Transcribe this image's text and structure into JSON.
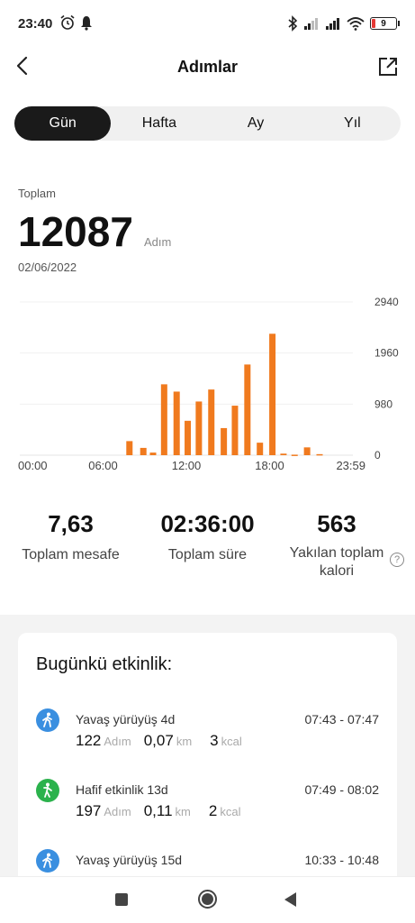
{
  "status_bar": {
    "time": "23:40",
    "battery": "9",
    "icons": [
      "alarm-icon",
      "bell-icon",
      "bluetooth-icon",
      "signal-icon",
      "signal-icon",
      "wifi-icon",
      "battery-icon"
    ]
  },
  "header": {
    "title": "Adımlar",
    "back_icon": "back-arrow-icon",
    "share_icon": "share-icon"
  },
  "tabs": [
    {
      "label": "Gün",
      "active": true
    },
    {
      "label": "Hafta",
      "active": false
    },
    {
      "label": "Ay",
      "active": false
    },
    {
      "label": "Yıl",
      "active": false
    }
  ],
  "summary": {
    "label": "Toplam",
    "steps": "12087",
    "unit": "Adım",
    "date": "02/06/2022"
  },
  "chart_data": {
    "type": "bar",
    "title": "",
    "xlabel": "",
    "ylabel": "",
    "x_tick_labels": [
      "00:00",
      "06:00",
      "12:00",
      "18:00",
      "23:59"
    ],
    "y_tick_labels": [
      "2940",
      "1960",
      "980",
      "0"
    ],
    "ylim": [
      0,
      2940
    ],
    "bar_color": "#f07a1e",
    "grid": true,
    "x_unit": "hour of day",
    "x": [
      7.9,
      8.9,
      9.6,
      10.4,
      11.3,
      12.1,
      12.9,
      13.8,
      14.7,
      15.5,
      16.4,
      17.3,
      18.2,
      19.0,
      19.8,
      20.7,
      21.6
    ],
    "values": [
      270,
      140,
      50,
      1360,
      1220,
      660,
      1030,
      1260,
      520,
      950,
      1740,
      240,
      2330,
      30,
      10,
      150,
      20
    ]
  },
  "stats": {
    "distance": {
      "value": "7,63",
      "label": "Toplam mesafe"
    },
    "duration": {
      "value": "02:36:00",
      "label": "Toplam süre"
    },
    "calories": {
      "value": "563",
      "label_line1": "Yakılan toplam",
      "label_line2": "kalori"
    }
  },
  "activity": {
    "title": "Bugünkü etkinlik:",
    "items": [
      {
        "name": "Yavaş yürüyüş 4d",
        "time": "07:43 - 07:47",
        "steps": "122",
        "steps_unit": "Adım",
        "km": "0,07",
        "km_unit": "km",
        "kcal": "3",
        "kcal_unit": "kcal",
        "icon": "walking-icon",
        "color": "#3a8fe0"
      },
      {
        "name": "Hafif etkinlik 13d",
        "time": "07:49 - 08:02",
        "steps": "197",
        "steps_unit": "Adım",
        "km": "0,11",
        "km_unit": "km",
        "kcal": "2",
        "kcal_unit": "kcal",
        "icon": "light-activity-icon",
        "color": "#2bb24c"
      },
      {
        "name": "Yavaş yürüyüş 15d",
        "time": "10:33 - 10:48",
        "icon": "walking-icon",
        "color": "#3a8fe0"
      }
    ]
  },
  "nav_bar": {
    "icons": [
      "recents-icon",
      "home-icon",
      "back-icon"
    ]
  }
}
